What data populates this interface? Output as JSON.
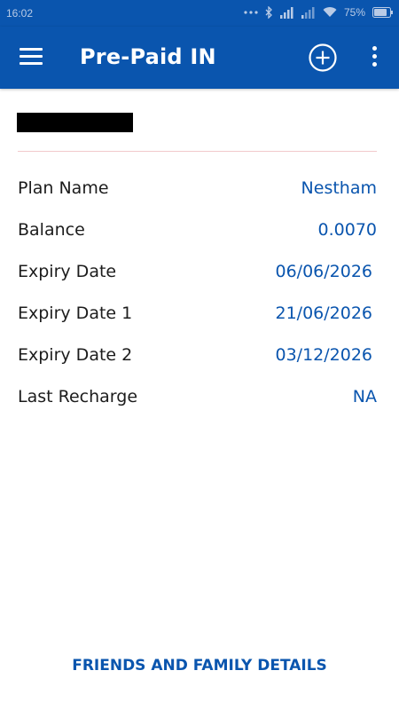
{
  "status_bar": {
    "time": "16:02",
    "battery": "75%"
  },
  "app_bar": {
    "title": "Pre-Paid IN"
  },
  "details": {
    "rows": [
      {
        "label": "Plan Name",
        "value": "Nestham"
      },
      {
        "label": "Balance",
        "value": "0.0070"
      },
      {
        "label": "Expiry Date",
        "value": "06/06/2026"
      },
      {
        "label": "Expiry Date 1",
        "value": "21/06/2026"
      },
      {
        "label": "Expiry Date 2",
        "value": "03/12/2026"
      },
      {
        "label": "Last Recharge",
        "value": "NA"
      }
    ]
  },
  "footer": {
    "link_label": "FRIENDS AND FAMILY DETAILS"
  },
  "colors": {
    "primary": "#0a55ae",
    "divider": "#f2c9cc",
    "text": "#1c1c1c"
  }
}
